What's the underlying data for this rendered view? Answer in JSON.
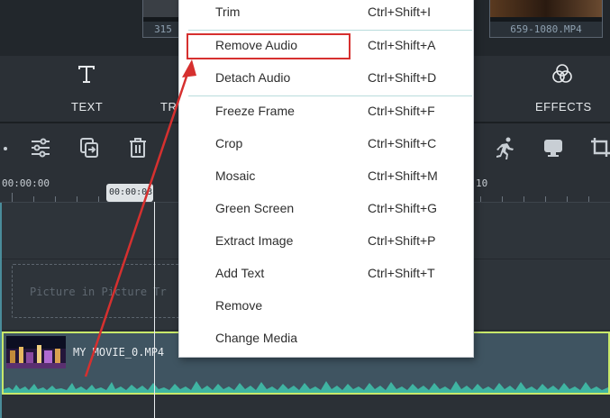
{
  "media": {
    "thumb_left_caption": "315",
    "thumb_right_caption": "659-1080.MP4"
  },
  "tabs": {
    "text_label": "TEXT",
    "transitions_label": "TR",
    "effects_label": "EFFECTS"
  },
  "ruler": {
    "start_time": "00:00:00",
    "playhead_time": "00:00:03",
    "right_time": "10"
  },
  "tracks": {
    "pip_placeholder": "Picture in Picture Tr",
    "clip_name": "MY MOVIE_0.MP4"
  },
  "context_menu": {
    "items": [
      {
        "label": "Trim",
        "shortcut": "Ctrl+Shift+I"
      },
      {
        "label": "Remove Audio",
        "shortcut": "Ctrl+Shift+A"
      },
      {
        "label": "Detach Audio",
        "shortcut": "Ctrl+Shift+D"
      },
      {
        "label": "Freeze Frame",
        "shortcut": "Ctrl+Shift+F"
      },
      {
        "label": "Crop",
        "shortcut": "Ctrl+Shift+C"
      },
      {
        "label": "Mosaic",
        "shortcut": "Ctrl+Shift+M"
      },
      {
        "label": "Green Screen",
        "shortcut": "Ctrl+Shift+G"
      },
      {
        "label": "Extract Image",
        "shortcut": "Ctrl+Shift+P"
      },
      {
        "label": "Add Text",
        "shortcut": "Ctrl+Shift+T"
      },
      {
        "label": "Remove",
        "shortcut": ""
      },
      {
        "label": "Change Media",
        "shortcut": ""
      }
    ]
  },
  "annotation": {
    "highlight_color": "#d6302f",
    "arrow_color": "#d6302f",
    "clip_border_color": "#c8e86a"
  },
  "icons": [
    "text-icon",
    "effects-icon",
    "adjust-icon",
    "copy-icon",
    "delete-icon",
    "run-icon",
    "monitor-icon",
    "crop-icon"
  ]
}
